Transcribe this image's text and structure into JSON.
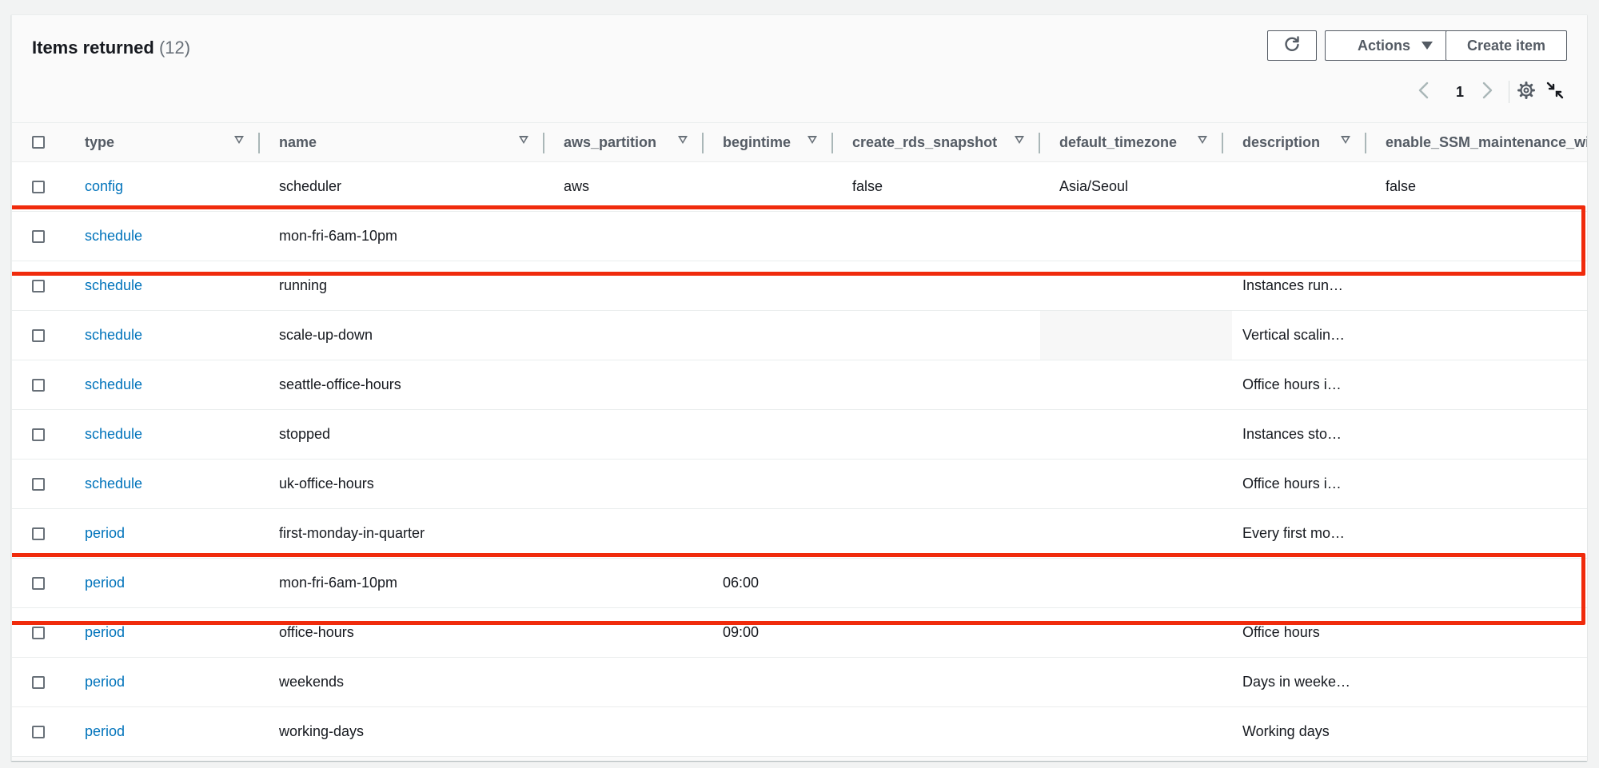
{
  "header": {
    "title": "Items returned",
    "count": "(12)",
    "actions_label": "Actions",
    "create_label": "Create item",
    "page_number": "1"
  },
  "columns": [
    {
      "label": "type"
    },
    {
      "label": "name"
    },
    {
      "label": "aws_partition"
    },
    {
      "label": "begintime"
    },
    {
      "label": "create_rds_snapshot"
    },
    {
      "label": "default_timezone"
    },
    {
      "label": "description"
    },
    {
      "label": "enable_SSM_maintenance_win"
    }
  ],
  "rows": [
    {
      "type": "config",
      "name": "scheduler",
      "aws_partition": "aws",
      "begintime": "",
      "create_rds_snapshot": "false",
      "default_timezone": "Asia/Seoul",
      "description": "",
      "enable_ssm": "false"
    },
    {
      "type": "schedule",
      "name": "mon-fri-6am-10pm",
      "aws_partition": "",
      "begintime": "",
      "create_rds_snapshot": "",
      "default_timezone": "",
      "description": "",
      "enable_ssm": ""
    },
    {
      "type": "schedule",
      "name": "running",
      "aws_partition": "",
      "begintime": "",
      "create_rds_snapshot": "",
      "default_timezone": "",
      "description": "Instances run…",
      "enable_ssm": ""
    },
    {
      "type": "schedule",
      "name": "scale-up-down",
      "aws_partition": "",
      "begintime": "",
      "create_rds_snapshot": "",
      "default_timezone": "",
      "description": "Vertical scalin…",
      "enable_ssm": ""
    },
    {
      "type": "schedule",
      "name": "seattle-office-hours",
      "aws_partition": "",
      "begintime": "",
      "create_rds_snapshot": "",
      "default_timezone": "",
      "description": "Office hours i…",
      "enable_ssm": ""
    },
    {
      "type": "schedule",
      "name": "stopped",
      "aws_partition": "",
      "begintime": "",
      "create_rds_snapshot": "",
      "default_timezone": "",
      "description": "Instances sto…",
      "enable_ssm": ""
    },
    {
      "type": "schedule",
      "name": "uk-office-hours",
      "aws_partition": "",
      "begintime": "",
      "create_rds_snapshot": "",
      "default_timezone": "",
      "description": "Office hours i…",
      "enable_ssm": ""
    },
    {
      "type": "period",
      "name": "first-monday-in-quarter",
      "aws_partition": "",
      "begintime": "",
      "create_rds_snapshot": "",
      "default_timezone": "",
      "description": "Every first mo…",
      "enable_ssm": ""
    },
    {
      "type": "period",
      "name": "mon-fri-6am-10pm",
      "aws_partition": "",
      "begintime": "06:00",
      "create_rds_snapshot": "",
      "default_timezone": "",
      "description": "",
      "enable_ssm": ""
    },
    {
      "type": "period",
      "name": "office-hours",
      "aws_partition": "",
      "begintime": "09:00",
      "create_rds_snapshot": "",
      "default_timezone": "",
      "description": "Office hours",
      "enable_ssm": ""
    },
    {
      "type": "period",
      "name": "weekends",
      "aws_partition": "",
      "begintime": "",
      "create_rds_snapshot": "",
      "default_timezone": "",
      "description": "Days in weeke…",
      "enable_ssm": ""
    },
    {
      "type": "period",
      "name": "working-days",
      "aws_partition": "",
      "begintime": "",
      "create_rds_snapshot": "",
      "default_timezone": "",
      "description": "Working days",
      "enable_ssm": ""
    }
  ],
  "highlighted_rows": [
    "mon-fri-6am-10pm (schedule)",
    "mon-fri-6am-10pm (period)"
  ],
  "colors": {
    "link": "#0073bb",
    "highlight": "#f02b0c",
    "text": "#16191f",
    "header_text": "#545b64"
  },
  "icons": {
    "refresh": "refresh-icon",
    "prev": "chevron-left-icon",
    "next": "chevron-right-icon",
    "settings": "gear-icon",
    "collapse": "collapse-icon",
    "sort": "sort-caret-icon",
    "actions_caret": "caret-down-icon"
  }
}
